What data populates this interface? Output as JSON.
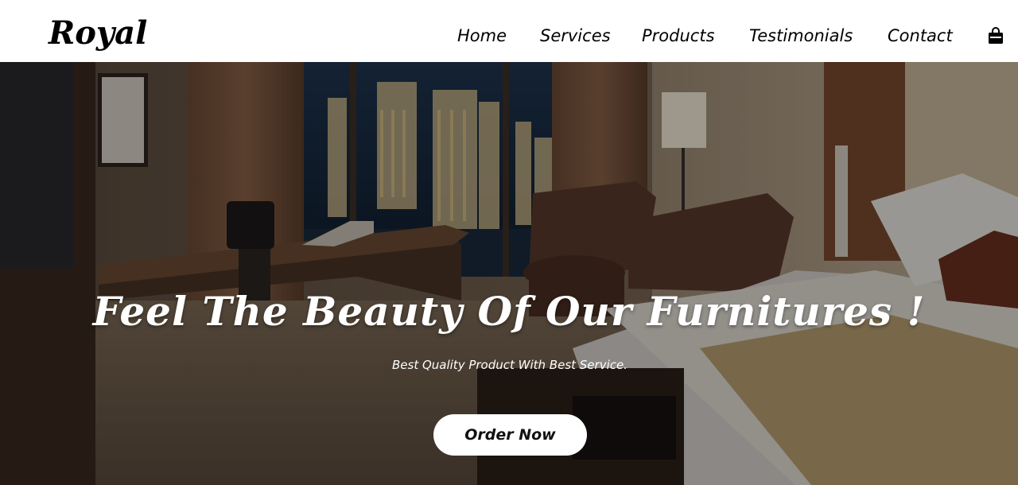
{
  "brand": {
    "logo_text": "Royal"
  },
  "nav": {
    "items": [
      {
        "label": "Home"
      },
      {
        "label": "Services"
      },
      {
        "label": "Products"
      },
      {
        "label": "Testimonials"
      },
      {
        "label": "Contact"
      }
    ],
    "cart_icon": "shopping-bag-icon"
  },
  "hero": {
    "title": "Feel The Beauty Of Our Furnitures !",
    "subtitle": "Best Quality Product With Best Service.",
    "cta_label": "Order Now",
    "background_description_icon": "hotel-room-photo"
  },
  "colors": {
    "header_bg": "#ffffff",
    "text_dark": "#000000",
    "hero_text": "#ffffff",
    "button_bg": "#ffffff"
  }
}
